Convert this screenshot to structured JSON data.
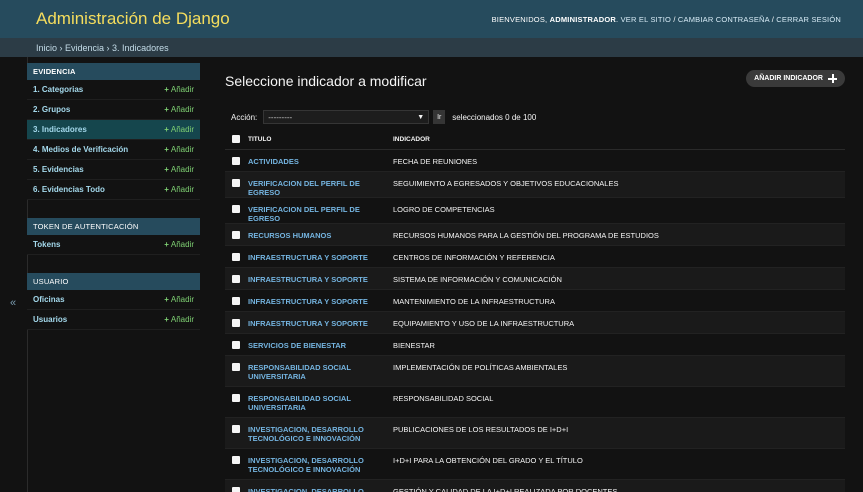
{
  "header": {
    "branding": "Administración de Django",
    "welcome": "BIENVENIDOS,",
    "username": "ADMINISTRADOR",
    "links": [
      "VER EL SITIO",
      "CAMBIAR CONTRASEÑA",
      "CERRAR SESIÓN"
    ]
  },
  "breadcrumbs": [
    "Inicio",
    "Evidencia",
    "3. Indicadores"
  ],
  "sidebar": {
    "modules": [
      {
        "caption": "EVIDENCIA",
        "items": [
          {
            "name": "1. Categorias",
            "add": "Añadir",
            "current": false
          },
          {
            "name": "2. Grupos",
            "add": "Añadir",
            "current": false
          },
          {
            "name": "3. Indicadores",
            "add": "Añadir",
            "current": true
          },
          {
            "name": "4. Medios de Verificación",
            "add": "Añadir",
            "current": false
          },
          {
            "name": "5. Evidencias",
            "add": "Añadir",
            "current": false
          },
          {
            "name": "6. Evidencias Todo",
            "add": "Añadir",
            "current": false
          }
        ]
      },
      {
        "caption": "TOKEN DE AUTENTICACIÓN",
        "items": [
          {
            "name": "Tokens",
            "add": "Añadir",
            "current": false
          }
        ]
      },
      {
        "caption": "USUARIO",
        "items": [
          {
            "name": "Oficinas",
            "add": "Añadir",
            "current": false
          },
          {
            "name": "Usuarios",
            "add": "Añadir",
            "current": false
          }
        ]
      }
    ],
    "toggle_glyph": "«"
  },
  "content": {
    "title": "Seleccione indicador a modificar",
    "add_button": "AÑADIR INDICADOR",
    "actions": {
      "label": "Acción:",
      "selected_value": "---------",
      "go_label": "Ir",
      "selected_count": "seleccionados 0 de 100"
    },
    "columns": [
      "TITULO",
      "INDICADOR"
    ],
    "rows": [
      {
        "titulo": "ACTIVIDADES",
        "indicador": "FECHA DE REUNIONES"
      },
      {
        "titulo": "VERIFICACION DEL PERFIL DE EGRESO",
        "indicador": "SEGUIMIENTO A EGRESADOS Y OBJETIVOS EDUCACIONALES"
      },
      {
        "titulo": "VERIFICACION DEL PERFIL DE EGRESO",
        "indicador": "LOGRO DE COMPETENCIAS"
      },
      {
        "titulo": "RECURSOS HUMANOS",
        "indicador": "RECURSOS HUMANOS PARA LA GESTIÓN DEL PROGRAMA DE ESTUDIOS"
      },
      {
        "titulo": "INFRAESTRUCTURA Y SOPORTE",
        "indicador": "CENTROS DE INFORMACIÓN Y REFERENCIA"
      },
      {
        "titulo": "INFRAESTRUCTURA Y SOPORTE",
        "indicador": "SISTEMA DE INFORMACIÓN Y COMUNICACIÓN"
      },
      {
        "titulo": "INFRAESTRUCTURA Y SOPORTE",
        "indicador": "MANTENIMIENTO DE LA INFRAESTRUCTURA"
      },
      {
        "titulo": "INFRAESTRUCTURA Y SOPORTE",
        "indicador": "EQUIPAMIENTO Y USO DE LA INFRAESTRUCTURA"
      },
      {
        "titulo": "SERVICIOS DE BIENESTAR",
        "indicador": "BIENESTAR"
      },
      {
        "titulo": "RESPONSABILIDAD SOCIAL UNIVERSITARIA",
        "indicador": "IMPLEMENTACIÓN DE POLÍTICAS AMBIENTALES"
      },
      {
        "titulo": "RESPONSABILIDAD SOCIAL UNIVERSITARIA",
        "indicador": "RESPONSABILIDAD SOCIAL"
      },
      {
        "titulo": "INVESTIGACION, DESARROLLO TECNOLÓGICO E INNOVACIÓN",
        "indicador": "PUBLICACIONES DE LOS RESULTADOS DE I+D+I"
      },
      {
        "titulo": "INVESTIGACION, DESARROLLO TECNOLÓGICO E INNOVACIÓN",
        "indicador": "I+D+I PARA LA OBTENCIÓN DEL GRADO Y EL TÍTULO"
      },
      {
        "titulo": "INVESTIGACION, DESARROLLO TECNOLÓGICO E INNOVACIÓN",
        "indicador": "GESTIÓN Y CALIDAD DE LA I+D+I REALIZADA POR DOCENTES"
      }
    ]
  },
  "colors": {
    "header_bg": "#264b5d",
    "branding": "#f5dd5d",
    "link": "#74b4e0",
    "add_link": "#7fd173",
    "current_row": "#15464d"
  }
}
